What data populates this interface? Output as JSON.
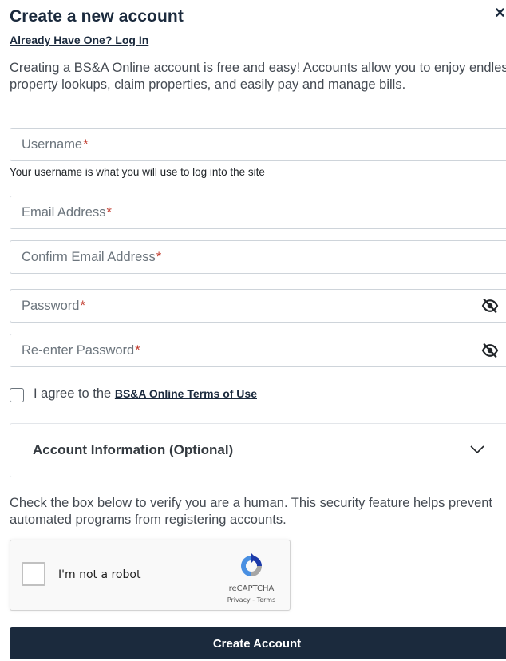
{
  "header": {
    "title": "Create a new account",
    "close_glyph": "×",
    "login_link": "Already Have One? Log In"
  },
  "intro": "Creating a BS&A Online account is free and easy! Accounts allow you to enjoy endless property lookups, claim properties, and easily pay and manage bills.",
  "form": {
    "required_marker": "*",
    "username": {
      "placeholder": "Username",
      "value": "",
      "help": "Your username is what you will use to log into the site"
    },
    "email": {
      "placeholder": "Email Address",
      "value": ""
    },
    "confirm_email": {
      "placeholder": "Confirm Email Address",
      "value": ""
    },
    "password": {
      "placeholder": "Password",
      "value": "",
      "toggle_icon": "eye-slash-icon"
    },
    "reenter_password": {
      "placeholder": "Re-enter Password",
      "value": "",
      "toggle_icon": "eye-slash-icon"
    },
    "terms": {
      "checked": false,
      "prefix": "I agree to the",
      "link": "BS&A Online Terms of Use"
    }
  },
  "accordion": {
    "title": "Account Information (Optional)",
    "expanded": false,
    "icon": "chevron-down-icon"
  },
  "verify_text": "Check the box below to verify you are a human. This security feature helps prevent automated programs from registering accounts.",
  "captcha": {
    "label": "I'm not a robot",
    "brand": "reCAPTCHA",
    "terms": "Privacy - Terms",
    "checked": false
  },
  "submit_label": "Create Account",
  "colors": {
    "primary": "#1b2a3d",
    "required": "#c0392b",
    "border": "#ced4da",
    "captcha_blue": "#1c3aa9",
    "captcha_light": "#4a90e2"
  }
}
